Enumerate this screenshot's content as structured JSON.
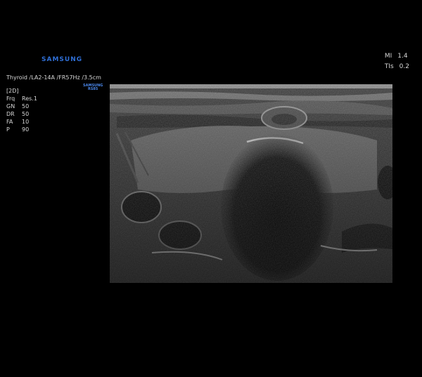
{
  "header": {
    "brand": "SAMSUNG",
    "preset": "Thyroid /LA2-14A /FR57Hz /3.5cm",
    "sublogo_line1": "SAMSUNG",
    "sublogo_line2": "RS85"
  },
  "params": {
    "mode": "[2D]",
    "rows": [
      {
        "key": "Frq",
        "value": "Res.1"
      },
      {
        "key": "GN",
        "value": "50"
      },
      {
        "key": "DR",
        "value": "50"
      },
      {
        "key": "FA",
        "value": "10"
      },
      {
        "key": "P",
        "value": "90"
      }
    ]
  },
  "indices": {
    "mi_label": "MI",
    "mi_value": "1.4",
    "tis_label": "TIs",
    "tis_value": "0.2"
  }
}
